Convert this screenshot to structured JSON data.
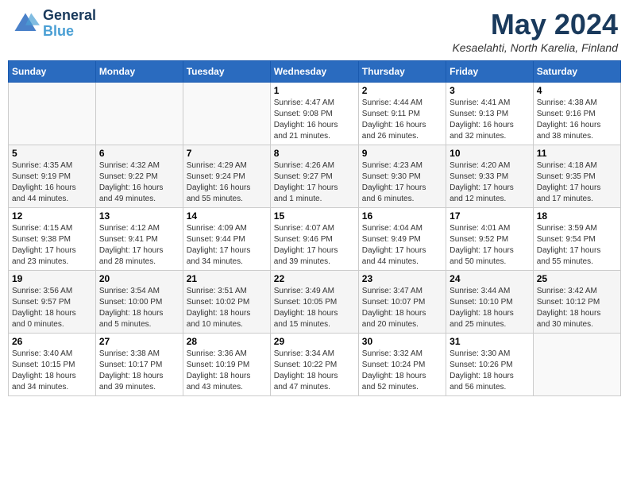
{
  "header": {
    "logo_line1": "General",
    "logo_line2": "Blue",
    "month_title": "May 2024",
    "location": "Kesaelahti, North Karelia, Finland"
  },
  "weekdays": [
    "Sunday",
    "Monday",
    "Tuesday",
    "Wednesday",
    "Thursday",
    "Friday",
    "Saturday"
  ],
  "weeks": [
    [
      {
        "day": "",
        "info": ""
      },
      {
        "day": "",
        "info": ""
      },
      {
        "day": "",
        "info": ""
      },
      {
        "day": "1",
        "info": "Sunrise: 4:47 AM\nSunset: 9:08 PM\nDaylight: 16 hours\nand 21 minutes."
      },
      {
        "day": "2",
        "info": "Sunrise: 4:44 AM\nSunset: 9:11 PM\nDaylight: 16 hours\nand 26 minutes."
      },
      {
        "day": "3",
        "info": "Sunrise: 4:41 AM\nSunset: 9:13 PM\nDaylight: 16 hours\nand 32 minutes."
      },
      {
        "day": "4",
        "info": "Sunrise: 4:38 AM\nSunset: 9:16 PM\nDaylight: 16 hours\nand 38 minutes."
      }
    ],
    [
      {
        "day": "5",
        "info": "Sunrise: 4:35 AM\nSunset: 9:19 PM\nDaylight: 16 hours\nand 44 minutes."
      },
      {
        "day": "6",
        "info": "Sunrise: 4:32 AM\nSunset: 9:22 PM\nDaylight: 16 hours\nand 49 minutes."
      },
      {
        "day": "7",
        "info": "Sunrise: 4:29 AM\nSunset: 9:24 PM\nDaylight: 16 hours\nand 55 minutes."
      },
      {
        "day": "8",
        "info": "Sunrise: 4:26 AM\nSunset: 9:27 PM\nDaylight: 17 hours\nand 1 minute."
      },
      {
        "day": "9",
        "info": "Sunrise: 4:23 AM\nSunset: 9:30 PM\nDaylight: 17 hours\nand 6 minutes."
      },
      {
        "day": "10",
        "info": "Sunrise: 4:20 AM\nSunset: 9:33 PM\nDaylight: 17 hours\nand 12 minutes."
      },
      {
        "day": "11",
        "info": "Sunrise: 4:18 AM\nSunset: 9:35 PM\nDaylight: 17 hours\nand 17 minutes."
      }
    ],
    [
      {
        "day": "12",
        "info": "Sunrise: 4:15 AM\nSunset: 9:38 PM\nDaylight: 17 hours\nand 23 minutes."
      },
      {
        "day": "13",
        "info": "Sunrise: 4:12 AM\nSunset: 9:41 PM\nDaylight: 17 hours\nand 28 minutes."
      },
      {
        "day": "14",
        "info": "Sunrise: 4:09 AM\nSunset: 9:44 PM\nDaylight: 17 hours\nand 34 minutes."
      },
      {
        "day": "15",
        "info": "Sunrise: 4:07 AM\nSunset: 9:46 PM\nDaylight: 17 hours\nand 39 minutes."
      },
      {
        "day": "16",
        "info": "Sunrise: 4:04 AM\nSunset: 9:49 PM\nDaylight: 17 hours\nand 44 minutes."
      },
      {
        "day": "17",
        "info": "Sunrise: 4:01 AM\nSunset: 9:52 PM\nDaylight: 17 hours\nand 50 minutes."
      },
      {
        "day": "18",
        "info": "Sunrise: 3:59 AM\nSunset: 9:54 PM\nDaylight: 17 hours\nand 55 minutes."
      }
    ],
    [
      {
        "day": "19",
        "info": "Sunrise: 3:56 AM\nSunset: 9:57 PM\nDaylight: 18 hours\nand 0 minutes."
      },
      {
        "day": "20",
        "info": "Sunrise: 3:54 AM\nSunset: 10:00 PM\nDaylight: 18 hours\nand 5 minutes."
      },
      {
        "day": "21",
        "info": "Sunrise: 3:51 AM\nSunset: 10:02 PM\nDaylight: 18 hours\nand 10 minutes."
      },
      {
        "day": "22",
        "info": "Sunrise: 3:49 AM\nSunset: 10:05 PM\nDaylight: 18 hours\nand 15 minutes."
      },
      {
        "day": "23",
        "info": "Sunrise: 3:47 AM\nSunset: 10:07 PM\nDaylight: 18 hours\nand 20 minutes."
      },
      {
        "day": "24",
        "info": "Sunrise: 3:44 AM\nSunset: 10:10 PM\nDaylight: 18 hours\nand 25 minutes."
      },
      {
        "day": "25",
        "info": "Sunrise: 3:42 AM\nSunset: 10:12 PM\nDaylight: 18 hours\nand 30 minutes."
      }
    ],
    [
      {
        "day": "26",
        "info": "Sunrise: 3:40 AM\nSunset: 10:15 PM\nDaylight: 18 hours\nand 34 minutes."
      },
      {
        "day": "27",
        "info": "Sunrise: 3:38 AM\nSunset: 10:17 PM\nDaylight: 18 hours\nand 39 minutes."
      },
      {
        "day": "28",
        "info": "Sunrise: 3:36 AM\nSunset: 10:19 PM\nDaylight: 18 hours\nand 43 minutes."
      },
      {
        "day": "29",
        "info": "Sunrise: 3:34 AM\nSunset: 10:22 PM\nDaylight: 18 hours\nand 47 minutes."
      },
      {
        "day": "30",
        "info": "Sunrise: 3:32 AM\nSunset: 10:24 PM\nDaylight: 18 hours\nand 52 minutes."
      },
      {
        "day": "31",
        "info": "Sunrise: 3:30 AM\nSunset: 10:26 PM\nDaylight: 18 hours\nand 56 minutes."
      },
      {
        "day": "",
        "info": ""
      }
    ]
  ]
}
